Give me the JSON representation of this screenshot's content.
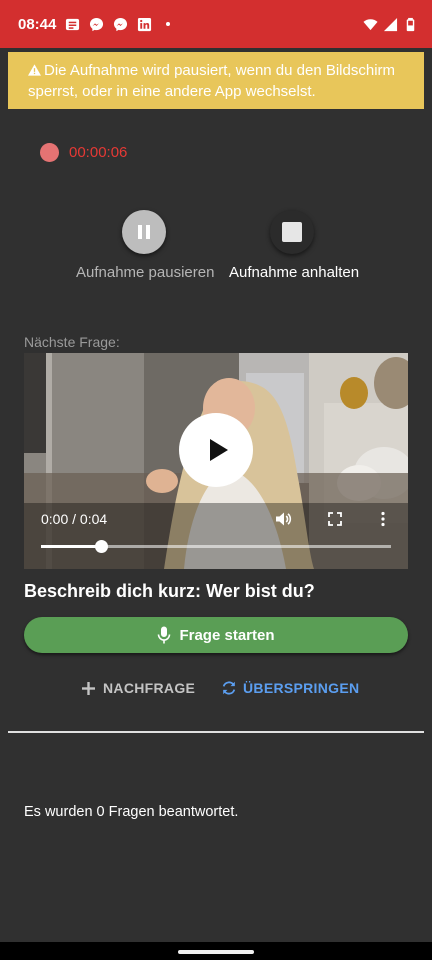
{
  "status_bar": {
    "time": "08:44",
    "notification_icons": [
      "news-icon",
      "messenger-icon",
      "messenger-icon",
      "linkedin-icon",
      "more-dot-icon"
    ],
    "system_icons": [
      "wifi-icon",
      "signal-icon",
      "battery-icon"
    ],
    "background": "#d32f2f"
  },
  "warning_banner": {
    "icon": "warning-icon",
    "text": "Die Aufnahme wird pausiert, wenn du den Bildschirm sperrst, oder in eine andere App wechselst.",
    "background": "#e8c65a"
  },
  "recording": {
    "elapsed": "00:00:06",
    "indicator_color": "#e57373"
  },
  "controls": {
    "pause_label": "Aufnahme pausieren",
    "stop_label": "Aufnahme anhalten"
  },
  "next_question": {
    "label": "Nächste Frage:",
    "video": {
      "current_time": "0:00",
      "duration": "0:04",
      "time_display": "0:00 / 0:04",
      "progress_fraction": 0.17,
      "icons": [
        "play-icon",
        "volume-icon",
        "fullscreen-icon",
        "more-vert-icon"
      ]
    },
    "text": "Beschreib dich kurz: Wer bist du?"
  },
  "start_button": {
    "label": "Frage starten",
    "icon": "mic-icon",
    "color": "#5a9e55"
  },
  "actions": {
    "followup_label": "NACHFRAGE",
    "skip_label": "ÜBERSPRINGEN",
    "skip_color": "#5b9ef0"
  },
  "summary": {
    "answered_text": "Es wurden 0 Fragen beantwortet."
  }
}
